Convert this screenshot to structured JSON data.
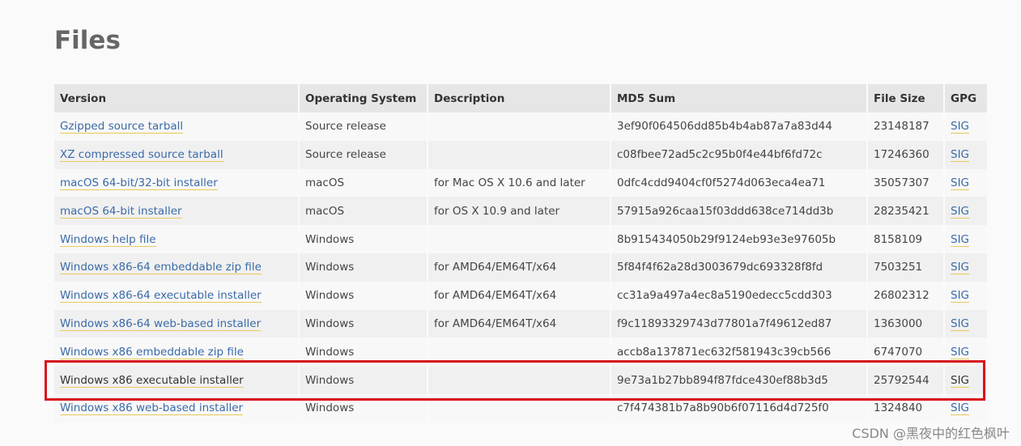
{
  "page": {
    "title": "Files"
  },
  "table": {
    "headers": [
      "Version",
      "Operating System",
      "Description",
      "MD5 Sum",
      "File Size",
      "GPG"
    ],
    "rows": [
      {
        "version": "Gzipped source tarball",
        "os": "Source release",
        "description": "",
        "md5": "3ef90f064506dd85b4b4ab87a7a83d44",
        "size": "23148187",
        "gpg": "SIG"
      },
      {
        "version": "XZ compressed source tarball",
        "os": "Source release",
        "description": "",
        "md5": "c08fbee72ad5c2c95b0f4e44bf6fd72c",
        "size": "17246360",
        "gpg": "SIG"
      },
      {
        "version": "macOS 64-bit/32-bit installer",
        "os": "macOS",
        "description": "for Mac OS X 10.6 and later",
        "md5": "0dfc4cdd9404cf0f5274d063eca4ea71",
        "size": "35057307",
        "gpg": "SIG"
      },
      {
        "version": "macOS 64-bit installer",
        "os": "macOS",
        "description": "for OS X 10.9 and later",
        "md5": "57915a926caa15f03ddd638ce714dd3b",
        "size": "28235421",
        "gpg": "SIG"
      },
      {
        "version": "Windows help file",
        "os": "Windows",
        "description": "",
        "md5": "8b915434050b29f9124eb93e3e97605b",
        "size": "8158109",
        "gpg": "SIG"
      },
      {
        "version": "Windows x86-64 embeddable zip file",
        "os": "Windows",
        "description": "for AMD64/EM64T/x64",
        "md5": "5f84f4f62a28d3003679dc693328f8fd",
        "size": "7503251",
        "gpg": "SIG"
      },
      {
        "version": "Windows x86-64 executable installer",
        "os": "Windows",
        "description": "for AMD64/EM64T/x64",
        "md5": "cc31a9a497a4ec8a5190edecc5cdd303",
        "size": "26802312",
        "gpg": "SIG"
      },
      {
        "version": "Windows x86-64 web-based installer",
        "os": "Windows",
        "description": "for AMD64/EM64T/x64",
        "md5": "f9c11893329743d77801a7f49612ed87",
        "size": "1363000",
        "gpg": "SIG"
      },
      {
        "version": "Windows x86 embeddable zip file",
        "os": "Windows",
        "description": "",
        "md5": "accb8a137871ec632f581943c39cb566",
        "size": "6747070",
        "gpg": "SIG"
      },
      {
        "version": "Windows x86 executable installer",
        "os": "Windows",
        "description": "",
        "md5": "9e73a1b27bb894f87fdce430ef88b3d5",
        "size": "25792544",
        "gpg": "SIG"
      },
      {
        "version": "Windows x86 web-based installer",
        "os": "Windows",
        "description": "",
        "md5": "c7f474381b7a8b90b6f07116d4d725f0",
        "size": "1324840",
        "gpg": "SIG"
      }
    ],
    "highlighted_row": 9
  },
  "colors": {
    "link": "#3a6aa8",
    "highlight_border": "#d8121c",
    "link_underline": "#e8c85c"
  },
  "watermark": "CSDN @黑夜中的红色枫叶"
}
